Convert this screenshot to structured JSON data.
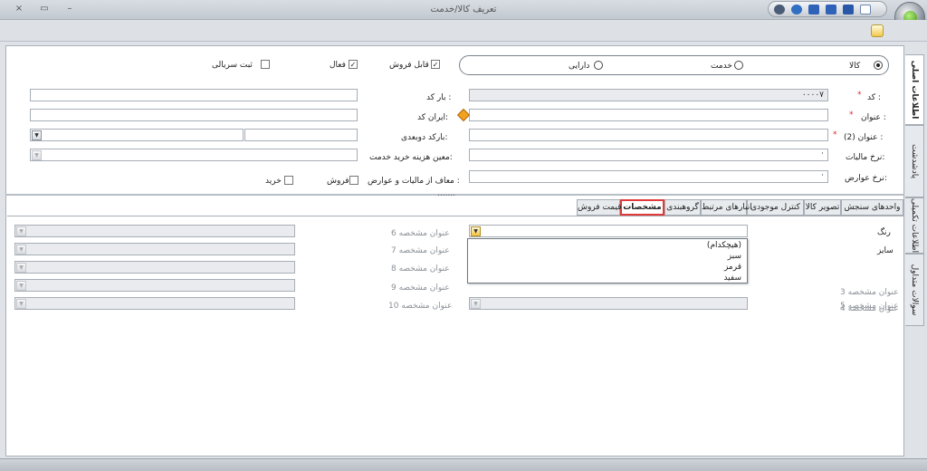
{
  "window": {
    "title": "تعریف کالا/خدمت"
  },
  "controls": {
    "close": "×",
    "maximize": "▭",
    "minimize": "–"
  },
  "item_type": {
    "options": [
      "کالا",
      "خدمت",
      "دارایی"
    ],
    "selected": "کالا"
  },
  "flags": [
    {
      "label": "قابل فروش",
      "checked": true
    },
    {
      "label": "فعال",
      "checked": true
    },
    {
      "label": "ثبت سریالی",
      "checked": false
    }
  ],
  "form": {
    "code_label": "کد :",
    "code_value": "۰۰۰۰۷",
    "title_label": "عنوان :",
    "title2_label": "عنوان (2) :",
    "tax_rate_label": "نرخ مالیات:",
    "duty_rate_label": "نرخ عوارض:",
    "barcode_label": "بار کد :",
    "irancode_label": "ایران کد:",
    "dual_barcode_label": "بارکد دوبعدی:",
    "service_cost_label": "معین هزینه خرید خدمت:",
    "exempt_label": "معاف از مالیات و عوارض :",
    "exempt_sale": "فروش",
    "exempt_purchase": "خرید",
    "required_mark": "*"
  },
  "side_tabs": [
    "اطلاعات اصلی",
    "پادشدشت",
    "اطلاعات تکمیلی",
    "سوالات متداول"
  ],
  "tabs": [
    {
      "label": "واحدهای سنجش",
      "active": false
    },
    {
      "label": "تصویر کالا",
      "active": false
    },
    {
      "label": "کنترل موجودی",
      "active": false
    },
    {
      "label": "انبارهای مرتبط",
      "active": false
    },
    {
      "label": "گروهبندی",
      "active": false
    },
    {
      "label": "مشخصات",
      "active": true
    },
    {
      "label": "قیمت فروش",
      "active": false
    }
  ],
  "specs": {
    "right": [
      "رنگ",
      "سایز",
      "عنوان مشخصه 3",
      "عنوان مشخصه 4",
      "عنوان مشخصه 5"
    ],
    "left": [
      "عنوان مشخصه 6",
      "عنوان مشخصه 7",
      "عنوان مشخصه 8",
      "عنوان مشخصه 9",
      "عنوان مشخصه 10"
    ]
  },
  "color_dropdown": {
    "items": [
      "(هیچکدام)",
      "سبز",
      "قرمز",
      "سفید"
    ]
  },
  "ribbon": {
    "ellipsis": "......."
  }
}
